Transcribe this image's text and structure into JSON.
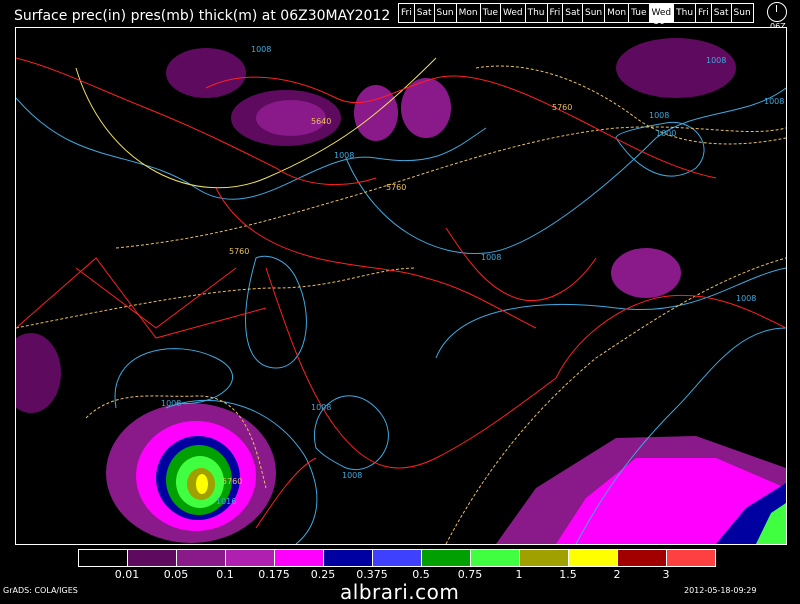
{
  "header": {
    "title": "Surface prec(in) pres(mb) thick(m) at 06Z30MAY2012",
    "days": [
      "Fri",
      "Sat",
      "Sun",
      "Mon",
      "Tue",
      "Wed",
      "Thu",
      "Fri",
      "Sat",
      "Sun",
      "Mon",
      "Tue",
      "Wed",
      "Thu",
      "Fri",
      "Sat",
      "Sun"
    ],
    "current_day": "Wed",
    "current_date": "30",
    "clock_label": "06Z"
  },
  "colorbar": {
    "colors": [
      "#000000",
      "#5e0a5e",
      "#8a1a8a",
      "#b020b0",
      "#ff00ff",
      "#0000a0",
      "#4040ff",
      "#00a000",
      "#40ff40",
      "#a0a000",
      "#ffff00",
      "#a00000",
      "#ff4040"
    ],
    "labels": [
      "0.01",
      "0.05",
      "0.1",
      "0.175",
      "0.25",
      "0.375",
      "0.5",
      "0.75",
      "1",
      "1.5",
      "2",
      "3"
    ]
  },
  "contour_labels": {
    "pressure": [
      "1008",
      "1008",
      "1008",
      "1008",
      "1008",
      "1008",
      "1008",
      "1000",
      "1008",
      "1016",
      "1008",
      "1008"
    ],
    "thickness": [
      "5640",
      "5760",
      "5760",
      "5760",
      "5760"
    ]
  },
  "footer": {
    "credit": "GrADS: COLA/IGES",
    "watermark": "albrari.com",
    "timestamp": "2012-05-18-09:29"
  },
  "colors": {
    "coastline": "#ff2020",
    "pressure_contour": "#3fa9e0",
    "thickness_contour": "#e8c060"
  }
}
